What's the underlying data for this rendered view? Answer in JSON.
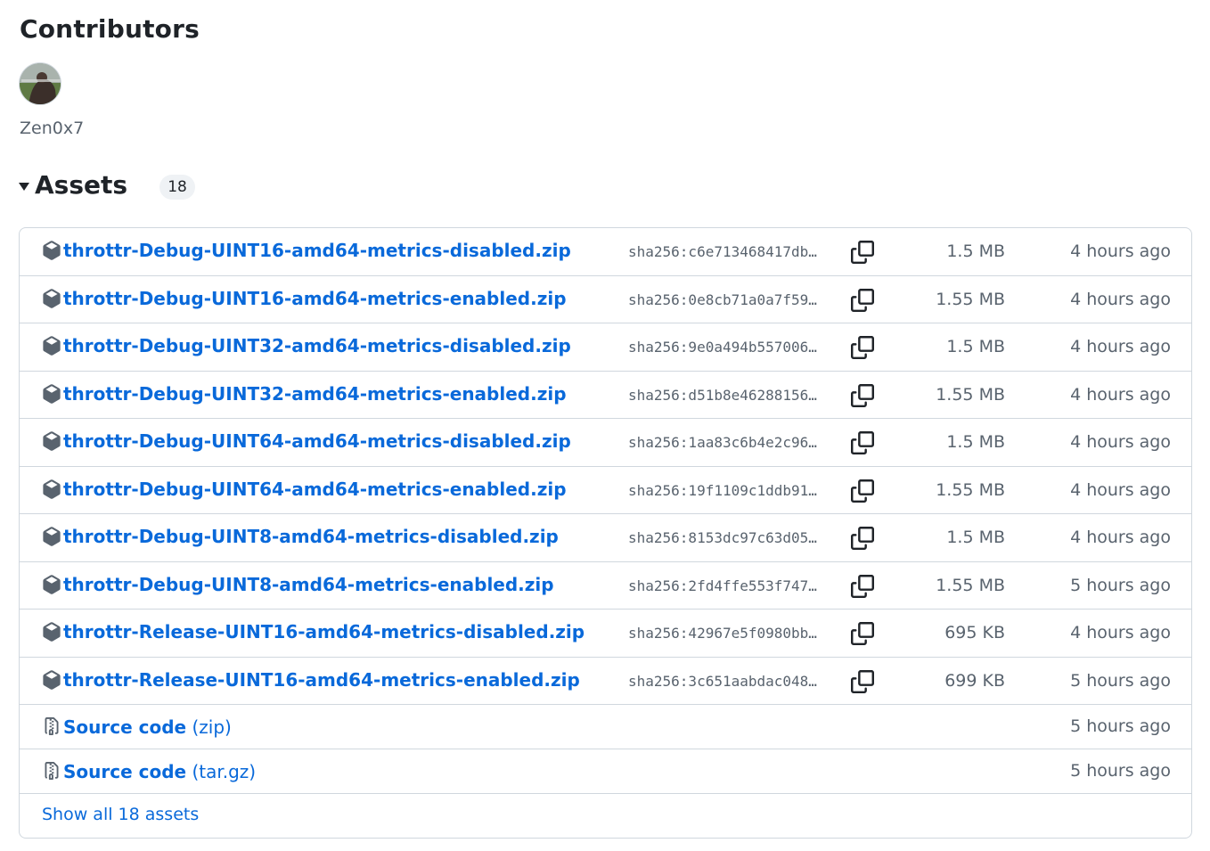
{
  "contributors": {
    "title": "Contributors",
    "items": [
      {
        "name": "Zen0x7"
      }
    ]
  },
  "assets": {
    "title": "Assets",
    "count": "18",
    "rows": [
      {
        "name": "throttr-Debug-UINT16-amd64-metrics-disabled.zip",
        "sha": "sha256:c6e713468417db…",
        "size": "1.5 MB",
        "time": "4 hours ago"
      },
      {
        "name": "throttr-Debug-UINT16-amd64-metrics-enabled.zip",
        "sha": "sha256:0e8cb71a0a7f59…",
        "size": "1.55 MB",
        "time": "4 hours ago"
      },
      {
        "name": "throttr-Debug-UINT32-amd64-metrics-disabled.zip",
        "sha": "sha256:9e0a494b557006…",
        "size": "1.5 MB",
        "time": "4 hours ago"
      },
      {
        "name": "throttr-Debug-UINT32-amd64-metrics-enabled.zip",
        "sha": "sha256:d51b8e46288156…",
        "size": "1.55 MB",
        "time": "4 hours ago"
      },
      {
        "name": "throttr-Debug-UINT64-amd64-metrics-disabled.zip",
        "sha": "sha256:1aa83c6b4e2c96…",
        "size": "1.5 MB",
        "time": "4 hours ago"
      },
      {
        "name": "throttr-Debug-UINT64-amd64-metrics-enabled.zip",
        "sha": "sha256:19f1109c1ddb91…",
        "size": "1.55 MB",
        "time": "4 hours ago"
      },
      {
        "name": "throttr-Debug-UINT8-amd64-metrics-disabled.zip",
        "sha": "sha256:8153dc97c63d05…",
        "size": "1.5 MB",
        "time": "4 hours ago"
      },
      {
        "name": "throttr-Debug-UINT8-amd64-metrics-enabled.zip",
        "sha": "sha256:2fd4ffe553f747…",
        "size": "1.55 MB",
        "time": "5 hours ago"
      },
      {
        "name": "throttr-Release-UINT16-amd64-metrics-disabled.zip",
        "sha": "sha256:42967e5f0980bb…",
        "size": "695 KB",
        "time": "4 hours ago"
      },
      {
        "name": "throttr-Release-UINT16-amd64-metrics-enabled.zip",
        "sha": "sha256:3c651aabdac048…",
        "size": "699 KB",
        "time": "5 hours ago"
      }
    ],
    "source": [
      {
        "label": "Source code",
        "format": "(zip)",
        "time": "5 hours ago"
      },
      {
        "label": "Source code",
        "format": "(tar.gz)",
        "time": "5 hours ago"
      }
    ],
    "show_all": "Show all 18 assets"
  },
  "colors": {
    "link": "#0969da",
    "muted": "#59636e",
    "border": "#d0d7de",
    "badge_bg": "#eff2f5"
  },
  "icons": {
    "asset": "package-icon",
    "source": "file-zip-icon",
    "copy": "copy-icon"
  }
}
